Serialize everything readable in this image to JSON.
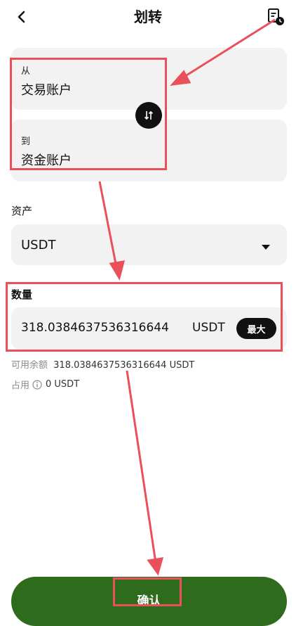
{
  "header": {
    "title": "划转"
  },
  "transfer": {
    "from_label": "从",
    "from_value": "交易账户",
    "to_label": "到",
    "to_value": "资金账户"
  },
  "asset": {
    "label": "资产",
    "selected": "USDT"
  },
  "amount": {
    "label": "数量",
    "value": "318.0384637536316644",
    "unit": "USDT",
    "max_label": "最大"
  },
  "info": {
    "available_label": "可用余额",
    "available_value": "318.0384637536316644 USDT",
    "occupied_label": "占用",
    "occupied_value": "0 USDT"
  },
  "confirm_label": "确认",
  "colors": {
    "accent": "#2e6b1d",
    "annotation": "#e9505a",
    "card_bg": "#f2f2f2"
  },
  "icons": [
    "back-arrow-icon",
    "history-icon",
    "swap-icon",
    "dropdown-caret-icon",
    "info-icon"
  ]
}
